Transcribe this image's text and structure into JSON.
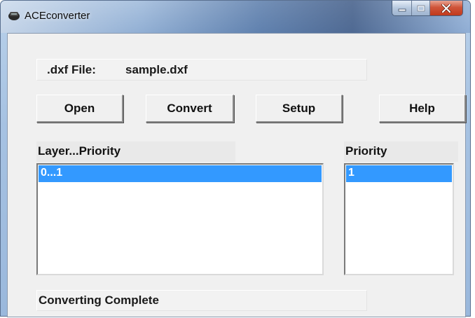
{
  "window": {
    "title": "ACEconverter",
    "icon": "app-icon"
  },
  "file": {
    "label": ".dxf File:",
    "value": "sample.dxf"
  },
  "buttons": {
    "open": "Open",
    "convert": "Convert",
    "setup": "Setup",
    "help": "Help"
  },
  "layers": {
    "header": "Layer...Priority",
    "items": [
      "0...1"
    ]
  },
  "priority": {
    "header": "Priority",
    "items": [
      "1"
    ]
  },
  "status": "Converting Complete",
  "colors": {
    "selection": "#3399ff",
    "close_button": "#c8452a",
    "face": "#f0f0f0"
  }
}
